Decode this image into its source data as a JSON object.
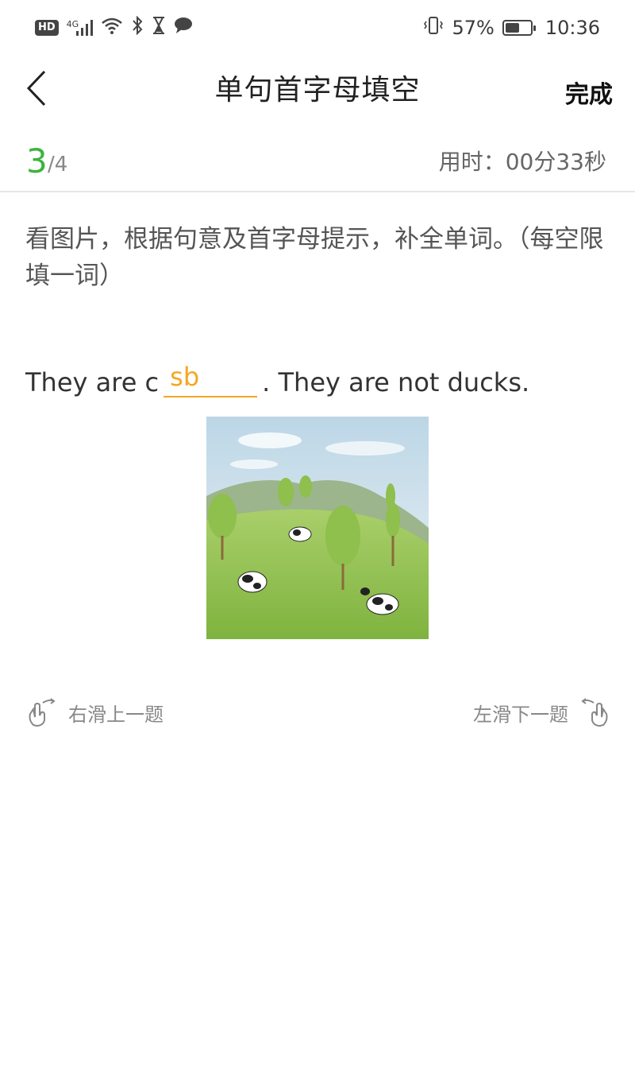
{
  "status_bar": {
    "hd": "HD",
    "network": "4G",
    "battery": "57%",
    "battery_level": 0.57,
    "time": "10:36"
  },
  "header": {
    "title": "单句首字母填空",
    "done_label": "完成"
  },
  "progress": {
    "current": "3",
    "total": "/4",
    "timer": "用时：00分33秒"
  },
  "question": {
    "instruction": "看图片，根据句意及首字母提示，补全单词。（每空限填一词）",
    "sentence_before": "They are c",
    "answer": "sb",
    "sentence_after": ". They are not ducks."
  },
  "navigation_hints": {
    "prev": "右滑上一题",
    "next": "左滑下一题"
  },
  "colors": {
    "accent_green": "#3cb43c",
    "answer_orange": "#f5a623"
  }
}
